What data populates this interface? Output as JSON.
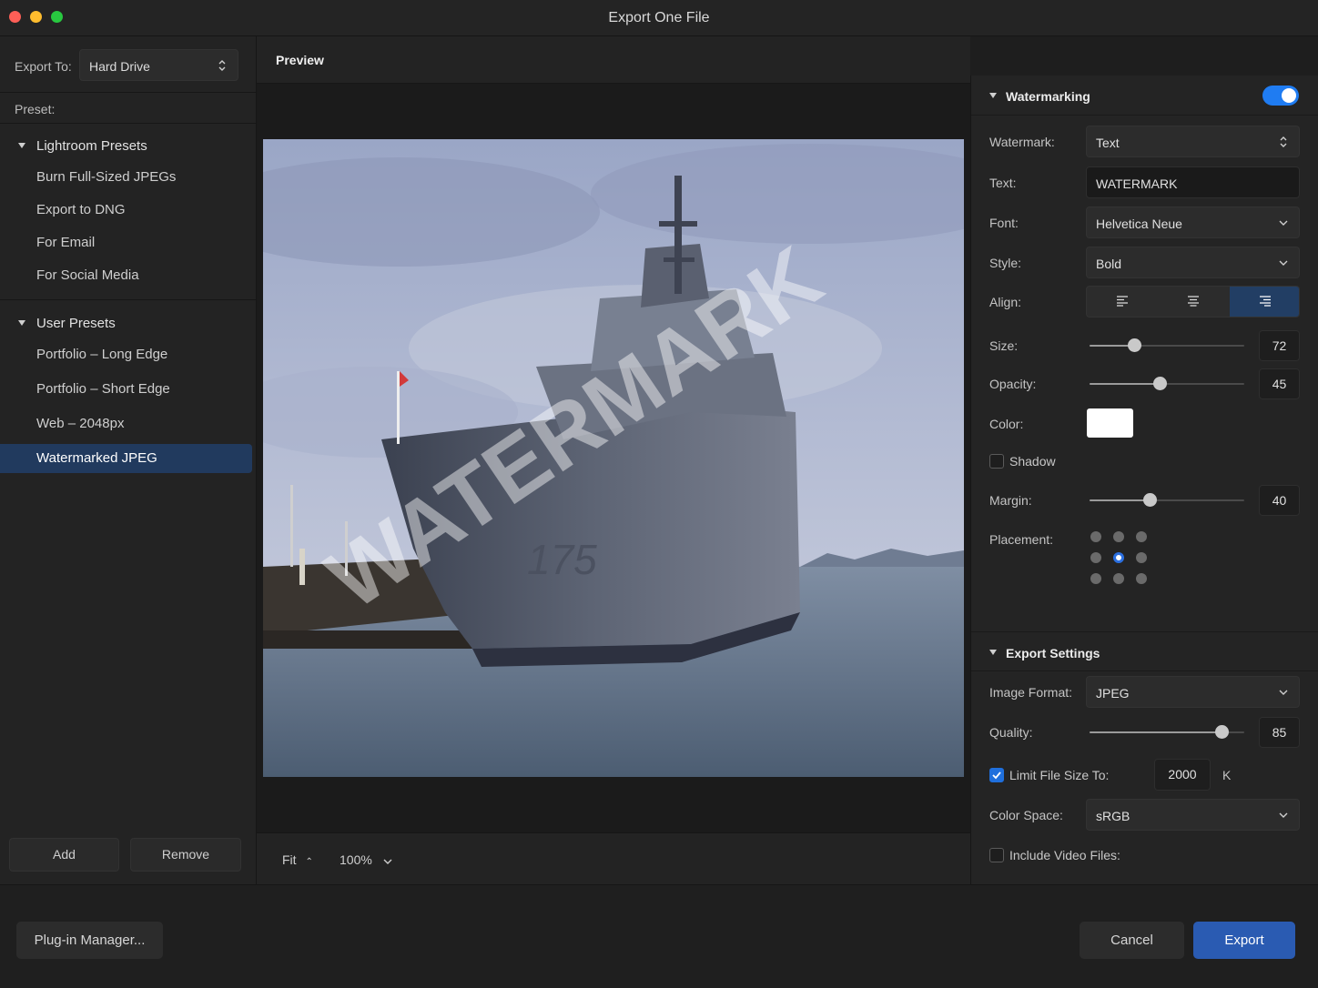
{
  "window": {
    "title": "Export One File"
  },
  "sidebar": {
    "export_to_label": "Export To:",
    "export_to_value": "Hard Drive",
    "preset_label": "Preset:",
    "groups": [
      {
        "title": "Lightroom Presets",
        "items": [
          "Burn Full-Sized JPEGs",
          "Export to DNG",
          "For Email",
          "For Social Media"
        ]
      },
      {
        "title": "User Presets",
        "items": [
          "Portfolio – Long Edge",
          "Portfolio – Short Edge",
          "Web – 2048px",
          "Watermarked JPEG"
        ]
      }
    ],
    "selected_preset": "Watermarked JPEG",
    "add_label": "Add",
    "remove_label": "Remove"
  },
  "preview": {
    "title": "Preview",
    "watermark_text": "WATERMARK",
    "hull_number": "175",
    "fit_label": "Fit",
    "zoom_label": "100%"
  },
  "watermarking": {
    "title": "Watermarking",
    "enabled": true,
    "watermark_label": "Watermark:",
    "watermark_value": "Text",
    "text_label": "Text:",
    "text_value": "WATERMARK",
    "font_label": "Font:",
    "font_value": "Helvetica Neue",
    "style_label": "Style:",
    "style_value": "Bold",
    "align_label": "Align:",
    "align_options": [
      "left",
      "center",
      "right"
    ],
    "align_selected": "right",
    "size_label": "Size:",
    "size_value": "72",
    "size_fraction": 0.29,
    "opacity_label": "Opacity:",
    "opacity_value": "45",
    "opacity_fraction": 0.45,
    "color_label": "Color:",
    "color_value": "#ffffff",
    "shadow_label": "Shadow",
    "shadow_checked": false,
    "margin_label": "Margin:",
    "margin_value": "40",
    "margin_fraction": 0.39,
    "placement_label": "Placement:",
    "placement_selected": "center"
  },
  "export_settings": {
    "title": "Export Settings",
    "image_format_label": "Image Format:",
    "image_format_value": "JPEG",
    "quality_label": "Quality:",
    "quality_value": "85",
    "quality_fraction": 0.85,
    "limit_label": "Limit File Size To:",
    "limit_checked": true,
    "limit_value": "2000",
    "limit_unit": "K",
    "color_space_label": "Color Space:",
    "color_space_value": "sRGB",
    "video_label": "Include Video Files:",
    "video_checked": false
  },
  "footer": {
    "plugin_label": "Plug-in Manager...",
    "cancel_label": "Cancel",
    "export_label": "Export"
  },
  "colors": {
    "accent": "#2a5bb2",
    "toggle_on": "#1f7cf2",
    "selection": "#213a5e"
  }
}
